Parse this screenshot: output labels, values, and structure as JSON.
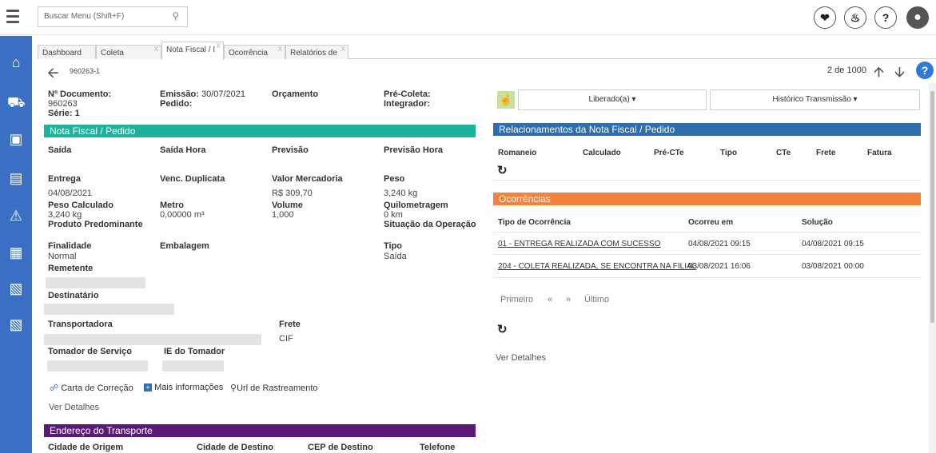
{
  "search": {
    "placeholder": "Buscar Menu (Shift+F)"
  },
  "tabs": [
    {
      "label": "Dashboard"
    },
    {
      "label": "Coleta"
    },
    {
      "label": "Nota Fiscal / I"
    },
    {
      "label": "Ocorrência"
    },
    {
      "label": "Relatórios de"
    }
  ],
  "record": {
    "id": "960263-1",
    "position": "2 de 1000"
  },
  "doc": {
    "numero_label": "Nº Documento:",
    "numero_value": "960263",
    "serie_label": "Série:",
    "serie_value": "1",
    "emissao_label": "Emissão:",
    "emissao_value": "30/07/2021",
    "pedido_label": "Pedido:",
    "orcamento_label": "Orçamento",
    "precoleta_label": "Pré-Coleta:",
    "integrador_label": "Integrador:"
  },
  "nota": {
    "header": "Nota Fiscal / Pedido",
    "saida": "Saída",
    "saida_hora": "Saída Hora",
    "previsao": "Previsão",
    "previsao_hora": "Previsão Hora",
    "entrega": "Entrega",
    "entrega_value": "04/08/2021",
    "venc": "Venc. Duplicata",
    "valor_merc": "Valor Mercadoria",
    "valor_merc_value": "R$ 309,70",
    "peso": "Peso",
    "peso_value": "3,240 kg",
    "peso_calc": "Peso Calculado",
    "peso_calc_value": "3,240 kg",
    "metro": "Metro",
    "metro_value": "0,00000 m³",
    "volume": "Volume",
    "volume_value": "1,000",
    "quilometragem": "Quilometragem",
    "quilometragem_value": "0 km",
    "produto": "Produto Predominante",
    "situacao": "Situação da Operação",
    "finalidade": "Finalidade",
    "finalidade_value": "Normal",
    "embalagem": "Embalagem",
    "tipo": "Tipo",
    "tipo_value": "Saída",
    "remetente": "Remetente",
    "destinatario": "Destinatário",
    "transportadora": "Transportadora",
    "frete": "Frete",
    "frete_value": "CIF",
    "tomador": "Tomador de Serviço",
    "ie_tomador": "IE do Tomador",
    "carta": "Carta de Correção",
    "mais_info": "Mais informações",
    "url_rastreamento": "Url de Rastreamento",
    "ver_detalhes": "Ver Detalhes"
  },
  "endereco": {
    "header": "Endereço do Transporte",
    "cidade_origem": "Cidade de Origem",
    "cidade_destino": "Cidade de Destino",
    "cep_destino": "CEP de Destino",
    "telefone": "Telefone"
  },
  "right": {
    "liberado": "Liberado(a) ▾",
    "historico": "Histórico Transmissão ▾",
    "relacionamentos_header": "Relacionamentos da Nota Fiscal / Pedido",
    "rel_columns": [
      "Romaneio",
      "Calculado",
      "Pré-CTe",
      "Tipo",
      "CTe",
      "Frete",
      "Fatura"
    ],
    "ocorrencias_header": "Ocorrências",
    "oc_columns": [
      "Tipo de Ocorrência",
      "Ocorreu em",
      "Solução"
    ],
    "oc_rows": [
      {
        "tipo": "01 - ENTREGA REALIZADA COM SUCESSO",
        "ocorreu": "04/08/2021 09:15",
        "solucao": "04/08/2021 09:15"
      },
      {
        "tipo": "204 - COLETA REALIZADA, SE ENCONTRA NA FILIAL",
        "ocorreu": "03/08/2021 16:06",
        "solucao": "03/08/2021 00:00"
      }
    ],
    "pager": {
      "first": "Primeiro",
      "prev": "«",
      "next": "»",
      "last": "Último"
    },
    "ver_detalhes": "Ver Detalhes"
  },
  "colors": {
    "sidebar": "#3b6fc4",
    "nota_header": "#1bb39b",
    "rel_header": "#2e6dae",
    "oc_header": "#f5823c",
    "end_header": "#5c1a78"
  }
}
